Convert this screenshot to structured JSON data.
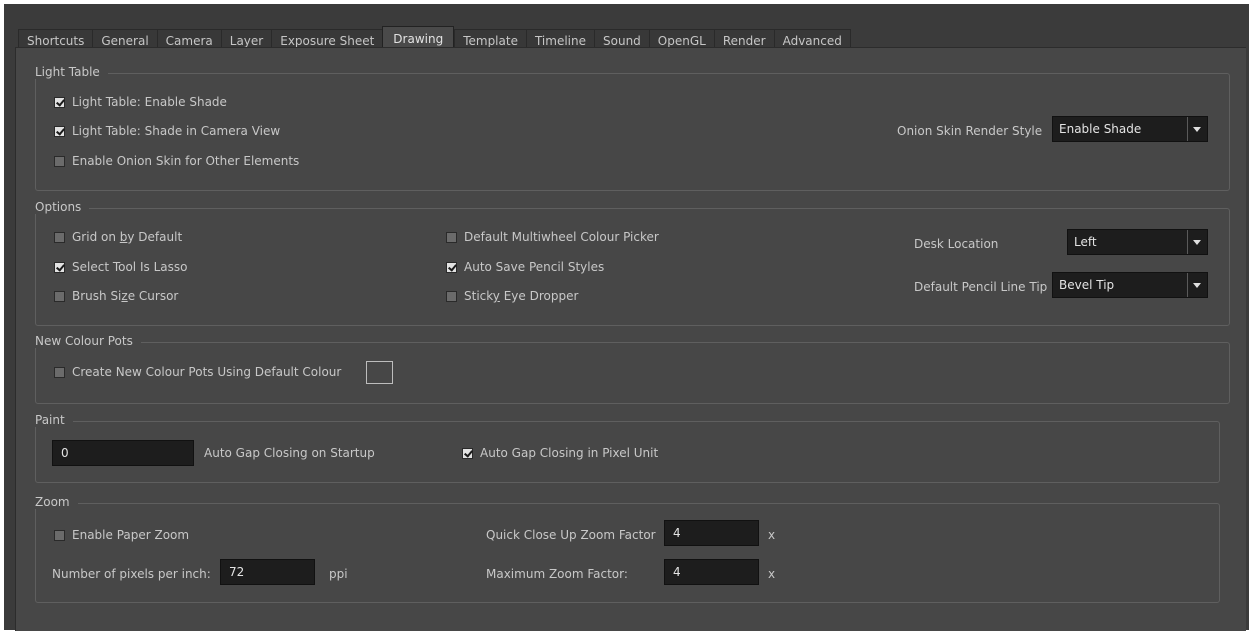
{
  "tabs": [
    "Shortcuts",
    "General",
    "Camera",
    "Layer",
    "Exposure Sheet",
    "Drawing",
    "Template",
    "Timeline",
    "Sound",
    "OpenGL",
    "Render",
    "Advanced"
  ],
  "active_tab": "Drawing",
  "light_table": {
    "title": "Light Table",
    "enable_shade": "Light Table: Enable Shade",
    "shade_camera": "Light Table: Shade in Camera View",
    "onion_other": "Enable Onion Skin for Other Elements",
    "onion_style_label": "Onion Skin Render Style",
    "onion_style_value": "Enable Shade"
  },
  "options": {
    "title": "Options",
    "grid_pre": "Grid on ",
    "grid_u": "b",
    "grid_post": "y Default",
    "select_lasso": "Select Tool Is Lasso",
    "brush_pre": "Brush Si",
    "brush_u": "z",
    "brush_post": "e Cursor",
    "multiwheel": "Default Multiwheel Colour Picker",
    "auto_save": "Auto Save Pencil Styles",
    "sticky_pre": "Stick",
    "sticky_u": "y",
    "sticky_post": " Eye Dropper",
    "desk_label": "Desk Location",
    "desk_value": "Left",
    "tip_label": "Default Pencil Line Tip",
    "tip_value": "Bevel Tip"
  },
  "colour_pots": {
    "title": "New Colour Pots",
    "create": "Create New Colour Pots Using Default Colour"
  },
  "paint": {
    "title": "Paint",
    "gap_value": "0",
    "gap_label": "Auto Gap Closing on Startup",
    "pixel_unit": "Auto Gap Closing in Pixel Unit"
  },
  "zoom": {
    "title": "Zoom",
    "paper_zoom": "Enable Paper Zoom",
    "ppi_label": "Number of pixels per inch:",
    "ppi_value": "72",
    "ppi_unit": "ppi",
    "quick_label": "Quick Close Up Zoom Factor",
    "quick_value": "4",
    "quick_unit": "x",
    "max_label": "Maximum Zoom Factor:",
    "max_value": "4",
    "max_unit": "x"
  },
  "colors": {
    "panel": "#474747",
    "tab_bar": "#3b3b3b",
    "field": "#1d1d1d"
  }
}
